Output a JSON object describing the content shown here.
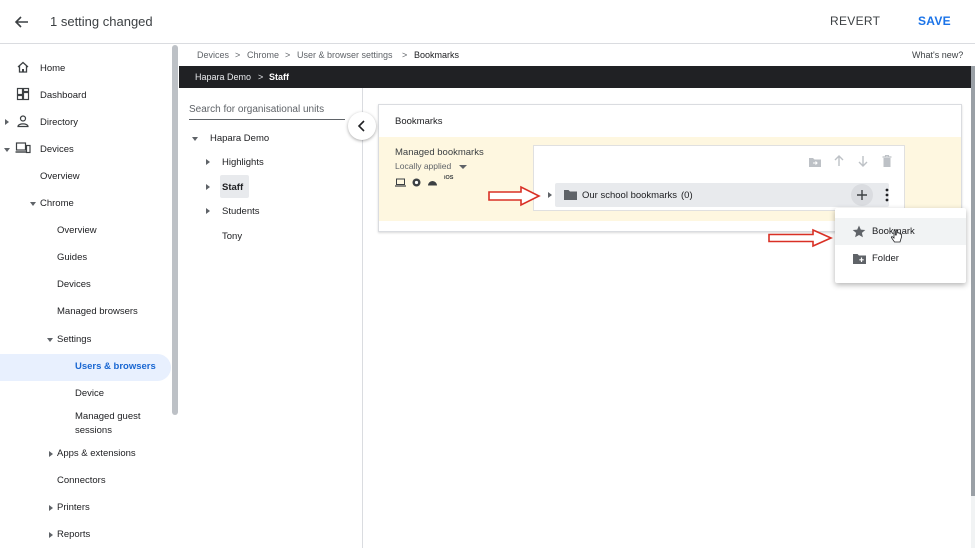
{
  "header": {
    "title": "1 setting changed",
    "revert_label": "REVERT",
    "save_label": "SAVE"
  },
  "nav": {
    "home": "Home",
    "dashboard": "Dashboard",
    "directory": "Directory",
    "devices": "Devices",
    "devices_overview": "Overview",
    "chrome": "Chrome",
    "chrome_overview": "Overview",
    "guides": "Guides",
    "chrome_devices": "Devices",
    "managed_browsers": "Managed browsers",
    "settings": "Settings",
    "users_browsers": "Users & browsers",
    "device": "Device",
    "managed_guest_1": "Managed guest",
    "managed_guest_2": "sessions",
    "apps_extensions": "Apps & extensions",
    "connectors": "Connectors",
    "printers": "Printers",
    "reports": "Reports"
  },
  "breadcrumb": {
    "items": [
      "Devices",
      "Chrome",
      "User & browser settings",
      "Bookmarks"
    ],
    "separator": ">",
    "whats_new": "What's new?"
  },
  "org_bar": {
    "root": "Hapara Demo",
    "separator": ">",
    "current": "Staff"
  },
  "org_tree": {
    "search_placeholder": "Search for organisational units",
    "root": "Hapara Demo",
    "children": [
      "Highlights",
      "Staff",
      "Students",
      "Tony"
    ],
    "selected": "Staff"
  },
  "bookmarks_card": {
    "title": "Bookmarks",
    "setting_label": "Managed bookmarks",
    "applied_label": "Locally applied",
    "platform_icons": [
      "laptop-icon",
      "chrome-icon",
      "android-icon",
      "ios-icon"
    ],
    "ios_text": "iOS",
    "folder_name": "Our school bookmarks",
    "folder_count": "(0)",
    "toolbar_icons": [
      "move-to-folder-icon",
      "arrow-up-icon",
      "arrow-down-icon",
      "delete-icon"
    ]
  },
  "add_menu": {
    "items": [
      {
        "label": "Bookmark",
        "icon": "star-icon"
      },
      {
        "label": "Folder",
        "icon": "add-folder-icon"
      }
    ]
  },
  "colors": {
    "accent": "#1a73e8",
    "highlight_bg": "#fef7e0",
    "annotation_arrow": "#d93025",
    "org_bar_bg": "#202124"
  }
}
